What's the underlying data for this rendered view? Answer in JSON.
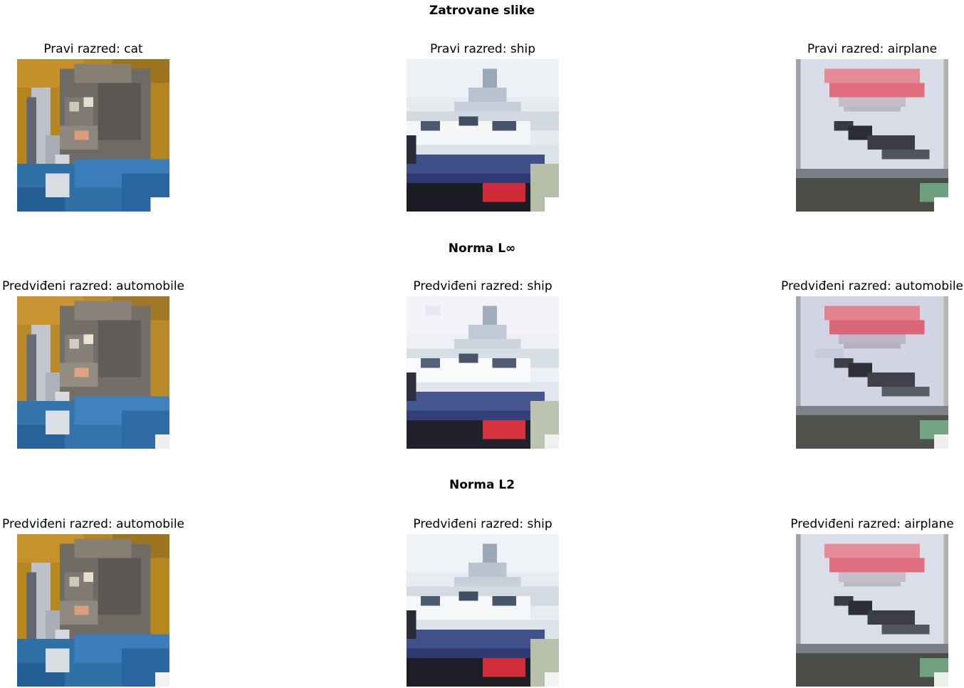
{
  "figure": {
    "rows": [
      {
        "heading": "Zatrovane slike",
        "panels": [
          {
            "title": "Pravi razred: cat",
            "image": "cat"
          },
          {
            "title": "Pravi razred: ship",
            "image": "ship"
          },
          {
            "title": "Pravi razred: airplane",
            "image": "airplane"
          }
        ]
      },
      {
        "heading": "Norma L∞",
        "panels": [
          {
            "title": "Predviđeni razred: automobile",
            "image": "cat"
          },
          {
            "title": "Predviđeni razred: ship",
            "image": "ship"
          },
          {
            "title": "Predviđeni razred: automobile",
            "image": "airplane"
          }
        ]
      },
      {
        "heading": "Norma L2",
        "panels": [
          {
            "title": "Predviđeni razred: automobile",
            "image": "cat"
          },
          {
            "title": "Predviđeni razred: ship",
            "image": "ship"
          },
          {
            "title": "Predviđeni razred: airplane",
            "image": "airplane"
          }
        ]
      }
    ]
  }
}
